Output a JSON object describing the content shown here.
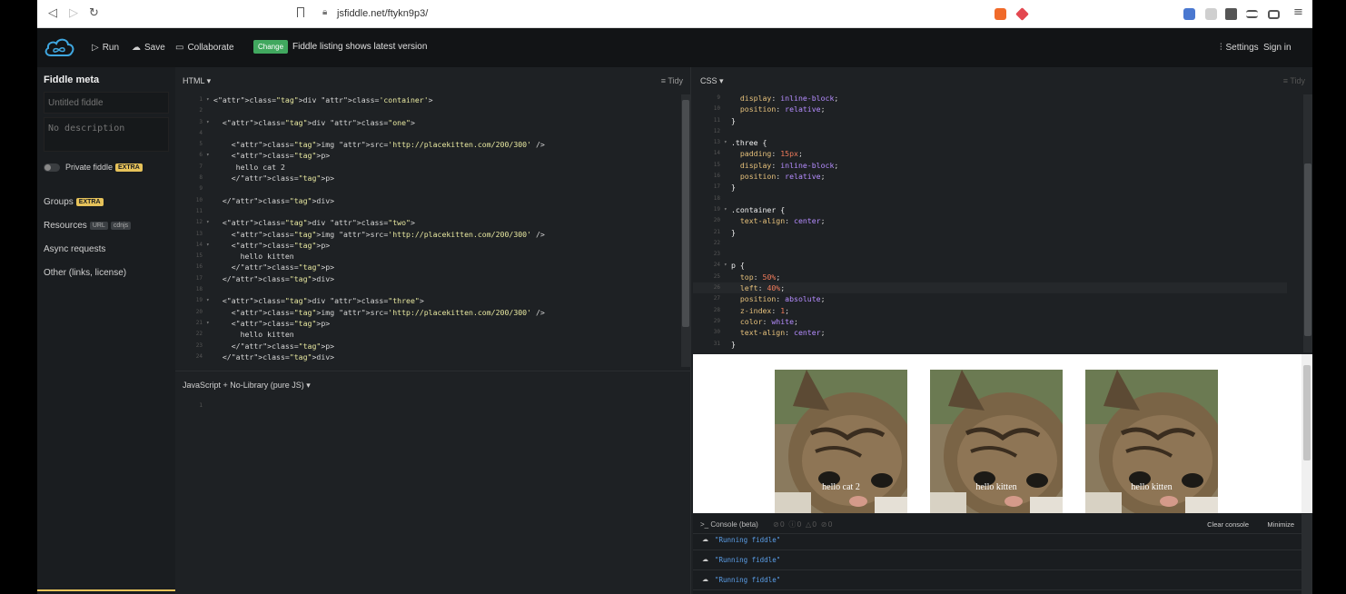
{
  "browser": {
    "url": "jsfiddle.net/ftykn9p3/",
    "back_icon": "back-arrow-icon",
    "forward_icon": "forward-arrow-icon",
    "reload_icon": "reload-icon"
  },
  "header": {
    "run_label": "Run",
    "save_label": "Save",
    "collaborate_label": "Collaborate",
    "change_badge": "Change",
    "listing_message": "Fiddle listing shows latest version",
    "settings_label": "Settings",
    "signin_label": "Sign in"
  },
  "sidebar": {
    "title": "Fiddle meta",
    "title_placeholder": "Untitled fiddle",
    "description_placeholder": "No description",
    "private_label": "Private fiddle",
    "extra_badge": "EXTRA",
    "groups_label": "Groups",
    "resources_label": "Resources",
    "url_badge": "URL",
    "cdnjs_badge": "cdnjs",
    "async_label": "Async requests",
    "other_label": "Other (links, license)"
  },
  "html_panel": {
    "lang_label": "HTML ▾",
    "tidy_label": "Tidy",
    "lines": [
      {
        "n": "1",
        "fold": "▾",
        "text": "<div class='container'>"
      },
      {
        "n": "2",
        "fold": "",
        "text": ""
      },
      {
        "n": "3",
        "fold": "▾",
        "text": "  <div class=\"one\">"
      },
      {
        "n": "4",
        "fold": "",
        "text": ""
      },
      {
        "n": "5",
        "fold": "",
        "text": "    <img src='http://placekitten.com/200/300' />"
      },
      {
        "n": "6",
        "fold": "▾",
        "text": "    <p>"
      },
      {
        "n": "7",
        "fold": "",
        "text": "     hello cat 2"
      },
      {
        "n": "8",
        "fold": "",
        "text": "    </p>"
      },
      {
        "n": "9",
        "fold": "",
        "text": ""
      },
      {
        "n": "10",
        "fold": "",
        "text": "  </div>"
      },
      {
        "n": "11",
        "fold": "",
        "text": ""
      },
      {
        "n": "12",
        "fold": "▾",
        "text": "  <div class=\"two\">"
      },
      {
        "n": "13",
        "fold": "",
        "text": "    <img src='http://placekitten.com/200/300' />"
      },
      {
        "n": "14",
        "fold": "▾",
        "text": "    <p>"
      },
      {
        "n": "15",
        "fold": "",
        "text": "      hello kitten"
      },
      {
        "n": "16",
        "fold": "",
        "text": "    </p>"
      },
      {
        "n": "17",
        "fold": "",
        "text": "  </div>"
      },
      {
        "n": "18",
        "fold": "",
        "text": ""
      },
      {
        "n": "19",
        "fold": "▾",
        "text": "  <div class=\"three\">"
      },
      {
        "n": "20",
        "fold": "",
        "text": "    <img src='http://placekitten.com/200/300' />"
      },
      {
        "n": "21",
        "fold": "▾",
        "text": "    <p>"
      },
      {
        "n": "22",
        "fold": "",
        "text": "      hello kitten"
      },
      {
        "n": "23",
        "fold": "",
        "text": "    </p>"
      },
      {
        "n": "24",
        "fold": "",
        "text": "  </div>"
      }
    ]
  },
  "js_panel": {
    "lang_label": "JavaScript + No-Library (pure JS) ▾",
    "lines": [
      {
        "n": "1",
        "text": ""
      }
    ]
  },
  "css_panel": {
    "lang_label": "CSS ▾",
    "tidy_label": "Tidy",
    "lines": [
      {
        "n": "9",
        "fold": "",
        "text": "  display: inline-block;"
      },
      {
        "n": "10",
        "fold": "",
        "text": "  position: relative;"
      },
      {
        "n": "11",
        "fold": "",
        "text": "}"
      },
      {
        "n": "12",
        "fold": "",
        "text": ""
      },
      {
        "n": "13",
        "fold": "▾",
        "text": ".three {"
      },
      {
        "n": "14",
        "fold": "",
        "text": "  padding: 15px;"
      },
      {
        "n": "15",
        "fold": "",
        "text": "  display: inline-block;"
      },
      {
        "n": "16",
        "fold": "",
        "text": "  position: relative;"
      },
      {
        "n": "17",
        "fold": "",
        "text": "}"
      },
      {
        "n": "18",
        "fold": "",
        "text": ""
      },
      {
        "n": "19",
        "fold": "▾",
        "text": ".container {"
      },
      {
        "n": "20",
        "fold": "",
        "text": "  text-align: center;"
      },
      {
        "n": "21",
        "fold": "",
        "text": "}"
      },
      {
        "n": "22",
        "fold": "",
        "text": ""
      },
      {
        "n": "23",
        "fold": "",
        "text": ""
      },
      {
        "n": "24",
        "fold": "▾",
        "text": "p {"
      },
      {
        "n": "25",
        "fold": "",
        "text": "  top: 50%;"
      },
      {
        "n": "26",
        "fold": "",
        "text": "  left: 40%;"
      },
      {
        "n": "27",
        "fold": "",
        "text": "  position: absolute;"
      },
      {
        "n": "28",
        "fold": "",
        "text": "  z-index: 1;"
      },
      {
        "n": "29",
        "fold": "",
        "text": "  color: white;"
      },
      {
        "n": "30",
        "fold": "",
        "text": "  text-align: center;"
      },
      {
        "n": "31",
        "fold": "",
        "text": "}"
      }
    ]
  },
  "result": {
    "captions": [
      "hello cat 2",
      "hello kitten",
      "hello kitten"
    ]
  },
  "console": {
    "title": "Console (beta)",
    "counts": "⊘0 ⓘ0 △0 ⊘0",
    "clear_label": "Clear console",
    "minimize_label": "Minimize",
    "messages": [
      "\"Running fiddle\"",
      "\"Running fiddle\"",
      "\"Running fiddle\""
    ]
  },
  "colors": {
    "accent_green": "#41a85f",
    "extra_badge": "#e6c25a",
    "bg": "#1e2124"
  }
}
